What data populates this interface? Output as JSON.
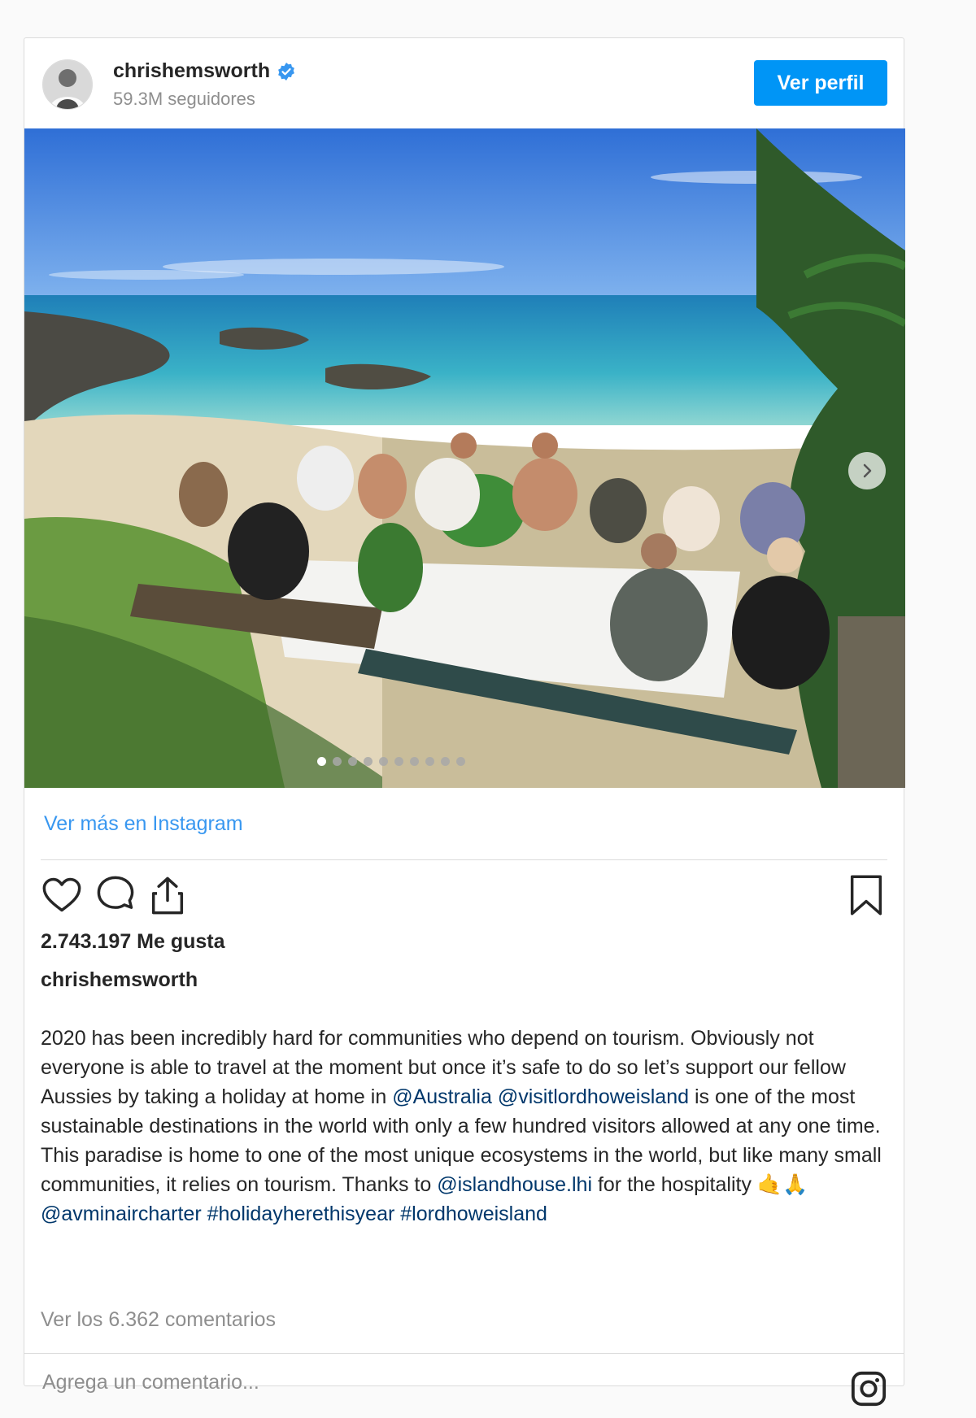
{
  "post": {
    "username": "chrishemsworth",
    "followers": "59.3M seguidores",
    "view_profile_label": "Ver perfil",
    "more_link": "Ver más en Instagram",
    "likes": "2.743.197 Me gusta",
    "caption": {
      "author": "chrishemsworth",
      "segments": [
        {
          "text": "2020 has been incredibly hard for communities who depend on tourism. Obviously not everyone is able to travel at the moment but once it’s safe to do so let’s support our fellow Aussies by taking a holiday at home in ",
          "tag": false
        },
        {
          "text": "@Australia",
          "tag": true
        },
        {
          "text": " ",
          "tag": false
        },
        {
          "text": "@visitlordhoweisland",
          "tag": true
        },
        {
          "text": " is one of the most sustainable destinations in the world with only a few hundred visitors allowed at any one time. This paradise is home to one of the most unique ecosystems in the world, but like many small communities, it relies on tourism. Thanks to ",
          "tag": false
        },
        {
          "text": "@islandhouse.lhi",
          "tag": true
        },
        {
          "text": " for the hospitality 🤙🙏 ",
          "tag": false
        },
        {
          "text": "@avminaircharter",
          "tag": true
        },
        {
          "text": " ",
          "tag": false
        },
        {
          "text": "#holidayherethisyear",
          "tag": true
        },
        {
          "text": " ",
          "tag": false
        },
        {
          "text": "#lordhoweisland",
          "tag": true
        }
      ]
    },
    "view_comments": "Ver los 6.362 comentarios",
    "comment_placeholder": "Agrega un comentario...",
    "carousel": {
      "total_slides": 10,
      "active_index": 0
    }
  },
  "colors": {
    "accent": "#0095f6",
    "link": "#3897f0",
    "tag": "#00376b",
    "muted": "#8e8e8e",
    "border": "#dbdbdb"
  },
  "icons": [
    "verified-badge-icon",
    "chevron-right-icon",
    "heart-icon",
    "comment-icon",
    "share-icon",
    "bookmark-icon",
    "instagram-logo-icon"
  ]
}
